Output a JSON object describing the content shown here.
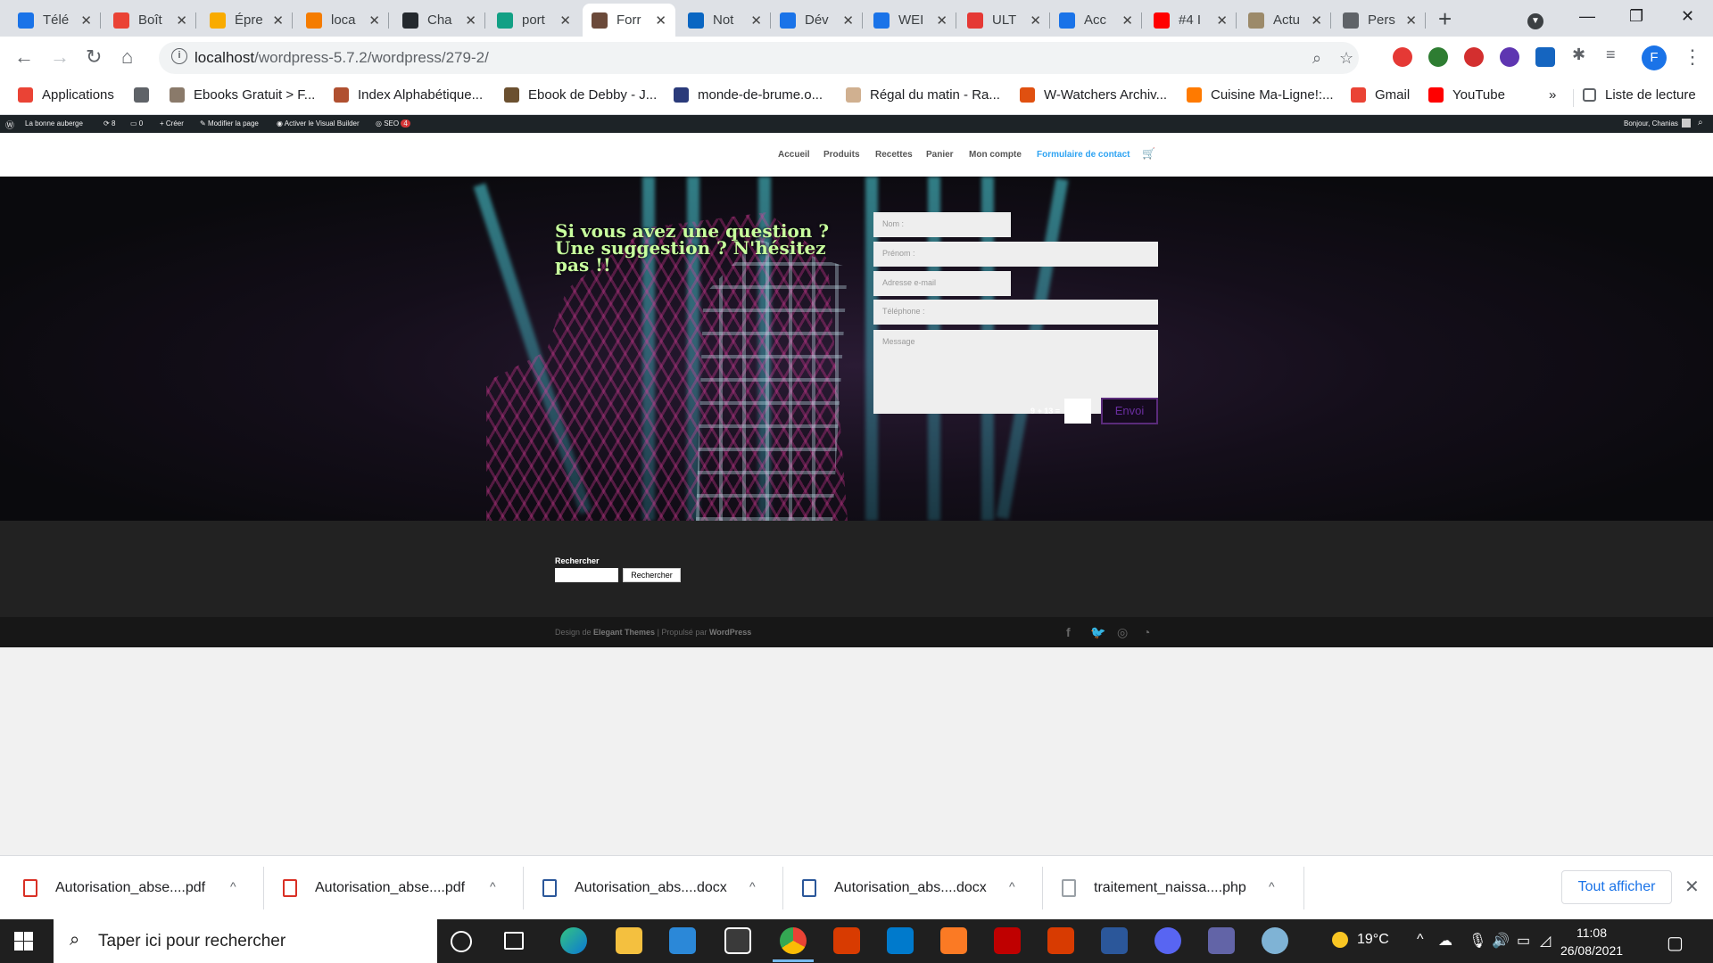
{
  "browser": {
    "tabs": [
      {
        "label": "Télé",
        "color": "#1a73e8"
      },
      {
        "label": "Boît",
        "color": "#ea4335"
      },
      {
        "label": "Épre",
        "color": "#f9ab00"
      },
      {
        "label": "loca",
        "color": "#f57c00"
      },
      {
        "label": "Cha",
        "color": "#24292e"
      },
      {
        "label": "port",
        "color": "#12a085"
      },
      {
        "label": "Forr",
        "color": "#6b4a3a"
      },
      {
        "label": "Not",
        "color": "#0a66c2"
      },
      {
        "label": "Dév",
        "color": "#1a73e8"
      },
      {
        "label": "WEI",
        "color": "#1a73e8"
      },
      {
        "label": "ULT",
        "color": "#e53935"
      },
      {
        "label": "Acc",
        "color": "#1a73e8"
      },
      {
        "label": "#4 I",
        "color": "#ff0000"
      },
      {
        "label": "Actu",
        "color": "#9c8a6a"
      },
      {
        "label": "Pers",
        "color": "#5f6368"
      }
    ],
    "url_host": "localhost",
    "url_path": "/wordpress-5.7.2/wordpress/279-2/",
    "profile_initial": "F",
    "bookmarks": [
      {
        "label": "Applications",
        "color": "#ea4335"
      },
      {
        "label": "",
        "color": "#5f6368"
      },
      {
        "label": "Ebooks Gratuit > F...",
        "color": "#8a7a6a"
      },
      {
        "label": "Index Alphabétique...",
        "color": "#b05030"
      },
      {
        "label": "Ebook de Debby - J...",
        "color": "#6b5030"
      },
      {
        "label": "monde-de-brume.o...",
        "color": "#2a3a7a"
      },
      {
        "label": "Régal du matin - Ra...",
        "color": "#d0b090"
      },
      {
        "label": "W-Watchers Archiv...",
        "color": "#e05010"
      },
      {
        "label": "Cuisine Ma-Ligne!:...",
        "color": "#ff7a00"
      },
      {
        "label": "Gmail",
        "color": "#ea4335"
      },
      {
        "label": "YouTube",
        "color": "#ff0000"
      }
    ],
    "bookmarks_more": "»",
    "reading_list": "Liste de lecture"
  },
  "wp": {
    "adminbar": {
      "site": "La bonne auberge",
      "updates": "8",
      "comments": "0",
      "create": "Créer",
      "edit_page": "Modifier la page",
      "visual_builder": "Activer le Visual Builder",
      "seo": "SEO",
      "seo_badge": "4",
      "greeting": "Bonjour, Chanias"
    },
    "menu": [
      "Accueil",
      "Produits",
      "Recettes",
      "Panier",
      "Mon compte",
      "Formulaire de contact"
    ],
    "cart_icon": "shopping-cart-icon",
    "hero_title": "Si vous avez une question ? Une suggestion ? N'hésitez pas !!",
    "form": {
      "nom": "Nom :",
      "prenom": "Prénom :",
      "email": "Adresse e-mail",
      "telephone": "Téléphone :",
      "message": "Message",
      "captcha": "9 + 13 =",
      "send": "Envoi"
    },
    "footer": {
      "search_label": "Rechercher",
      "search_button": "Rechercher",
      "credit_prefix": "Design de ",
      "credit_theme": "Elegant Themes",
      "credit_mid": " | Propulsé par ",
      "credit_wp": "WordPress"
    }
  },
  "downloads": [
    {
      "name": "Autorisation_abse....pdf",
      "type": "pdf"
    },
    {
      "name": "Autorisation_abse....pdf",
      "type": "pdf"
    },
    {
      "name": "Autorisation_abs....docx",
      "type": "docx"
    },
    {
      "name": "Autorisation_abs....docx",
      "type": "docx"
    },
    {
      "name": "traitement_naissa....php",
      "type": "php"
    }
  ],
  "downloads_show_all": "Tout afficher",
  "taskbar": {
    "search_placeholder": "Taper ici pour rechercher",
    "weather": "19°C",
    "time": "11:08",
    "date": "26/08/2021"
  },
  "colors": {
    "accent": "#2ea3f2",
    "hero_title": "#c8ff9e",
    "send_button": "#6a2ea0"
  }
}
